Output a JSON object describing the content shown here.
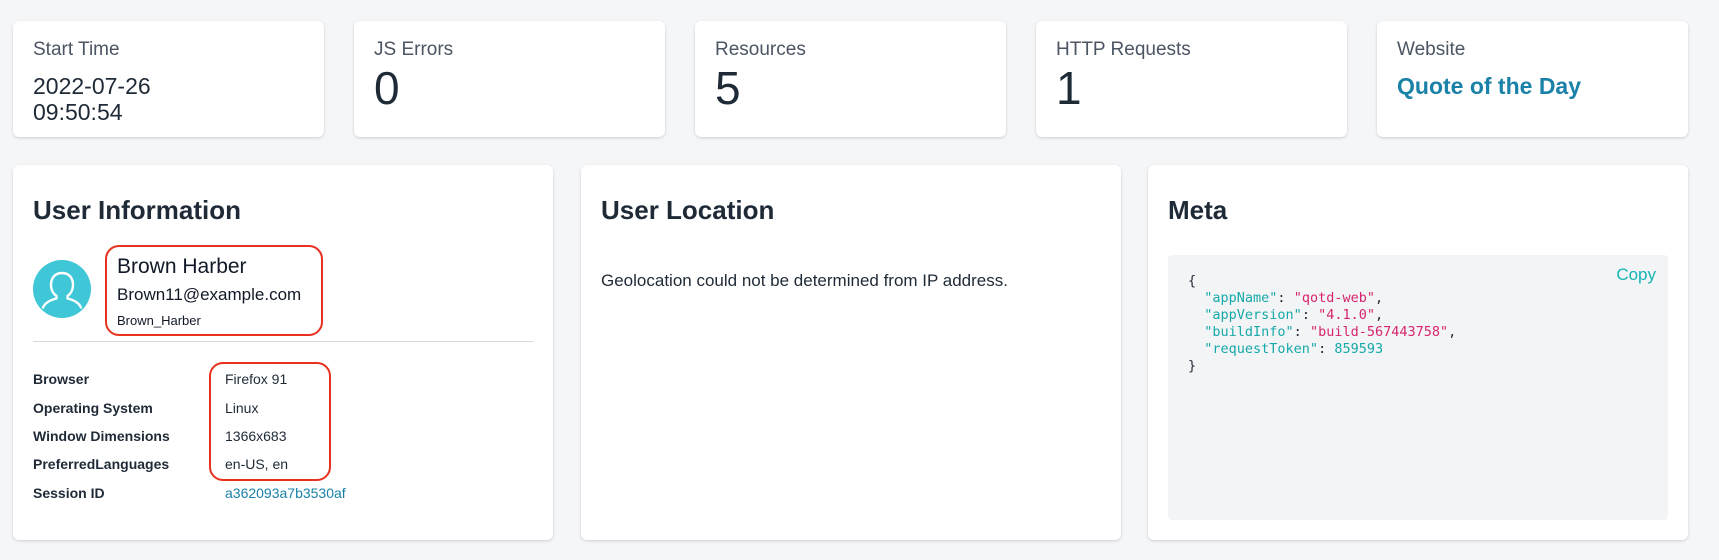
{
  "stats": [
    {
      "label": "Start Time",
      "value_line1": "2022-07-26",
      "value_line2": "09:50:54"
    },
    {
      "label": "JS Errors",
      "value": "0"
    },
    {
      "label": "Resources",
      "value": "5"
    },
    {
      "label": "HTTP Requests",
      "value": "1"
    },
    {
      "label": "Website",
      "link": "Quote of the Day"
    }
  ],
  "user_info": {
    "title": "User Information",
    "name": "Brown Harber",
    "email": "Brown11@example.com",
    "username": "Brown_Harber",
    "rows": [
      {
        "label": "Browser",
        "value": "Firefox 91"
      },
      {
        "label": "Operating System",
        "value": "Linux"
      },
      {
        "label": "Window Dimensions",
        "value": "1366x683"
      },
      {
        "label": "PreferredLanguages",
        "value": "en-US, en"
      },
      {
        "label": "Session ID",
        "value": "a362093a7b3530af"
      }
    ]
  },
  "location": {
    "title": "User Location",
    "message": "Geolocation could not be determined from IP address."
  },
  "meta": {
    "title": "Meta",
    "copy_label": "Copy",
    "entries": [
      {
        "key": "\"appName\"",
        "value": "\"qotd-web\""
      },
      {
        "key": "\"appVersion\"",
        "value": "\"4.1.0\""
      },
      {
        "key": "\"buildInfo\"",
        "value": "\"build-567443758\""
      },
      {
        "key": "\"requestToken\"",
        "value": "859593"
      }
    ]
  },
  "colors": {
    "accent_link": "#1a81a8",
    "copy_teal": "#13b5b5",
    "annotation_red": "#e8321f",
    "avatar_bg": "#3fc7d8"
  },
  "icons": {
    "avatar": "user-silhouette-icon"
  }
}
